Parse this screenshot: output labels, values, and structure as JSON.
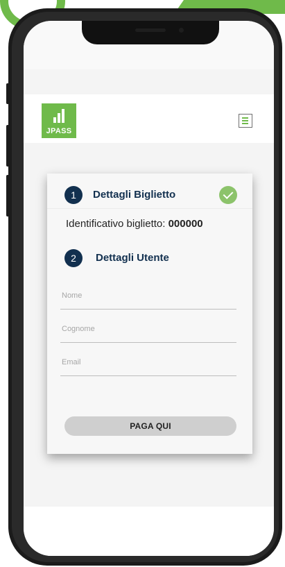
{
  "colors": {
    "brand_green": "#6fba4a",
    "step_navy": "#12304f",
    "check_green": "#8cc36b",
    "button_grey": "#cfcfcf"
  },
  "header": {
    "logo_text": "JPASS",
    "menu_icon": "hamburger-menu-icon"
  },
  "steps": [
    {
      "number": "1",
      "title": "Dettagli Biglietto",
      "status_icon": "check-icon"
    },
    {
      "number": "2",
      "title": "Dettagli Utente"
    }
  ],
  "ticket": {
    "label": "Identificativo biglietto: ",
    "value": "000000"
  },
  "form": {
    "name_placeholder": "Nome",
    "surname_placeholder": "Cognome",
    "email_placeholder": "Email",
    "submit_label": "PAGA QUI"
  }
}
